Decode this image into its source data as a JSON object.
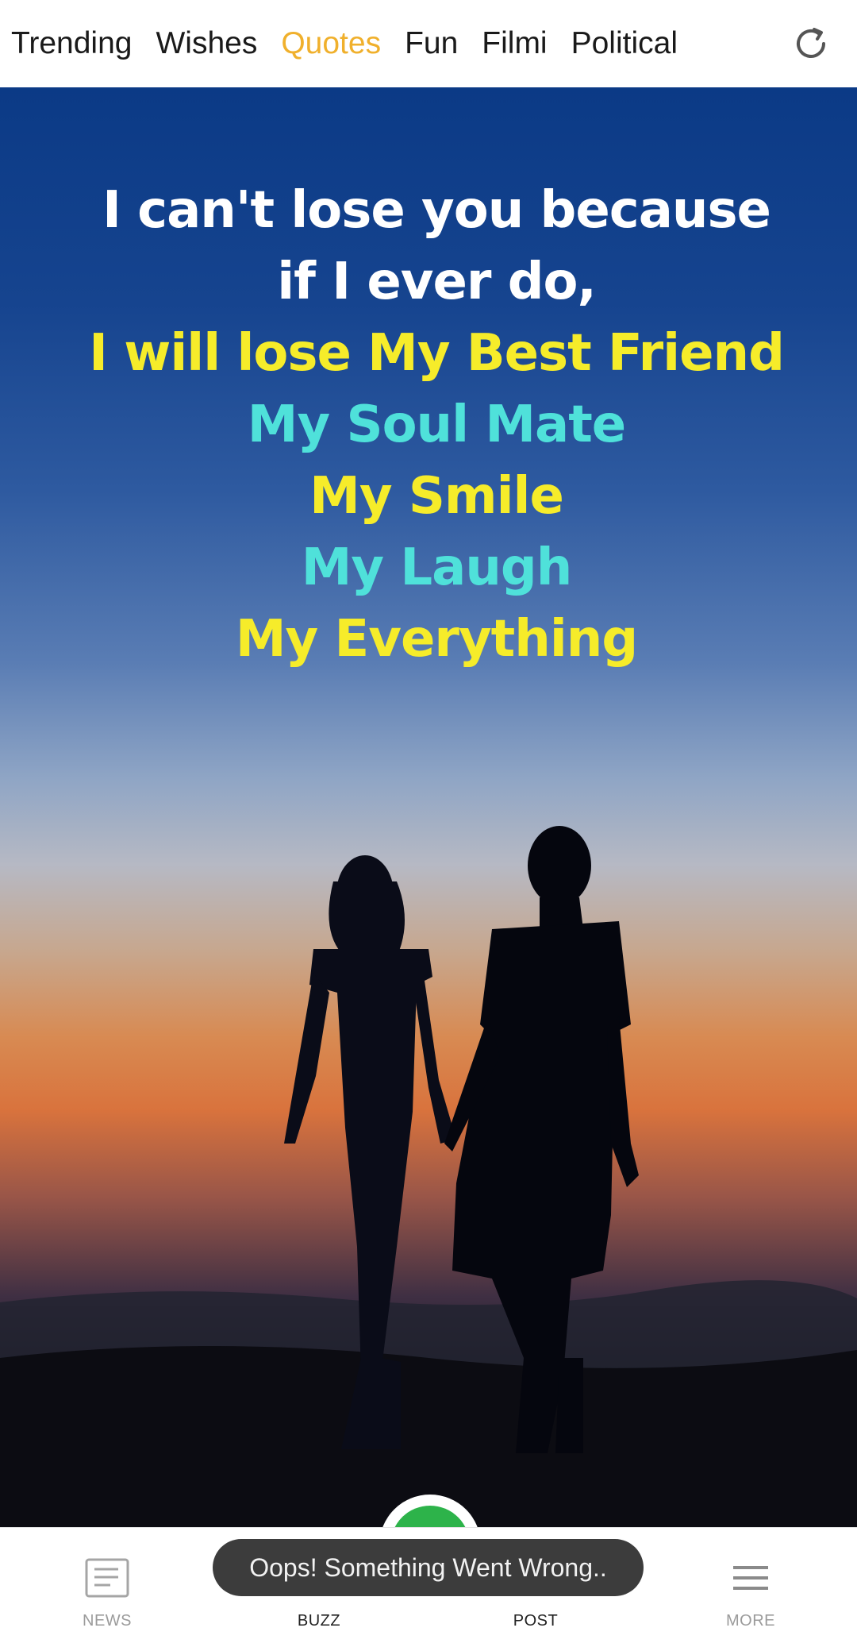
{
  "tabs": [
    {
      "label": "Trending",
      "active": false
    },
    {
      "label": "Wishes",
      "active": false
    },
    {
      "label": "Quotes",
      "active": true
    },
    {
      "label": "Fun",
      "active": false
    },
    {
      "label": "Filmi",
      "active": false
    },
    {
      "label": "Political",
      "active": false
    }
  ],
  "topbar": {
    "refresh_icon": "refresh-icon"
  },
  "post": {
    "quote_lines": [
      {
        "text": "I can't lose you because",
        "color": "#ffffff"
      },
      {
        "text": "if I ever do,",
        "color": "#ffffff"
      },
      {
        "text": "I will lose My Best Friend",
        "color": "#f6ec2a"
      },
      {
        "text": "My Soul Mate",
        "color": "#4fe1da"
      },
      {
        "text": "My Smile",
        "color": "#f6ec2a"
      },
      {
        "text": "My Laugh",
        "color": "#4fe1da"
      },
      {
        "text": "My Everything",
        "color": "#f6ec2a"
      }
    ]
  },
  "bottom_nav": {
    "news": "NEWS",
    "buzz": "BUZZ",
    "post": "POST",
    "more": "MORE"
  },
  "toast": {
    "message": "Oops! Something Went Wrong.."
  },
  "colors": {
    "active_tab": "#f0b02c",
    "fab": "#2db34a"
  }
}
